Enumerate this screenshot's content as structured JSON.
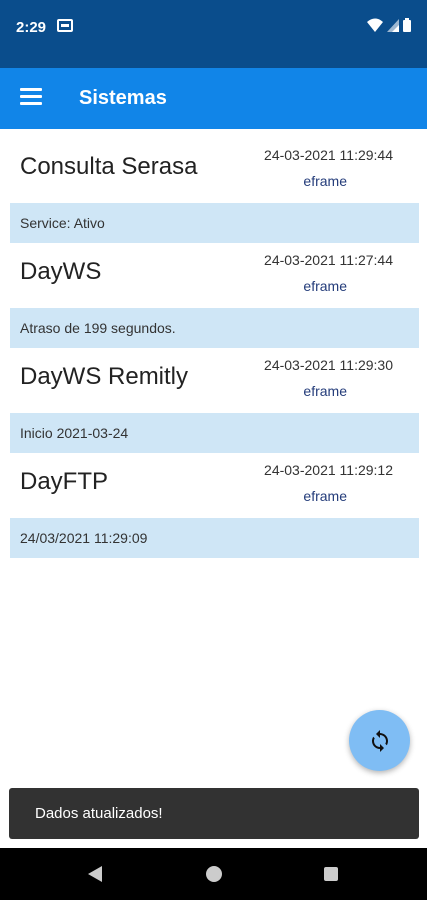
{
  "status_bar": {
    "time": "2:29"
  },
  "app_bar": {
    "title": "Sistemas"
  },
  "systems": [
    {
      "name": "Consulta Serasa",
      "datetime": "24-03-2021 11:29:44",
      "user": "eframe",
      "status": "Service: Ativo"
    },
    {
      "name": "DayWS",
      "datetime": "24-03-2021 11:27:44",
      "user": "eframe",
      "status": "Atraso de 199 segundos."
    },
    {
      "name": "DayWS Remitly",
      "datetime": "24-03-2021 11:29:30",
      "user": "eframe",
      "status": "Inicio 2021-03-24"
    },
    {
      "name": "DayFTP",
      "datetime": "24-03-2021 11:29:12",
      "user": "eframe",
      "status": "24/03/2021 11:29:09"
    }
  ],
  "snackbar": {
    "message": "Dados atualizados!"
  },
  "colors": {
    "status_bar": "#0a4d8c",
    "app_bar": "#1185e8",
    "status_row": "#cfe6f6",
    "fab": "#7fbdf4"
  },
  "icons": {
    "menu": "menu-icon",
    "refresh": "refresh-icon",
    "back": "back-icon",
    "home": "home-icon",
    "recents": "recents-icon"
  }
}
